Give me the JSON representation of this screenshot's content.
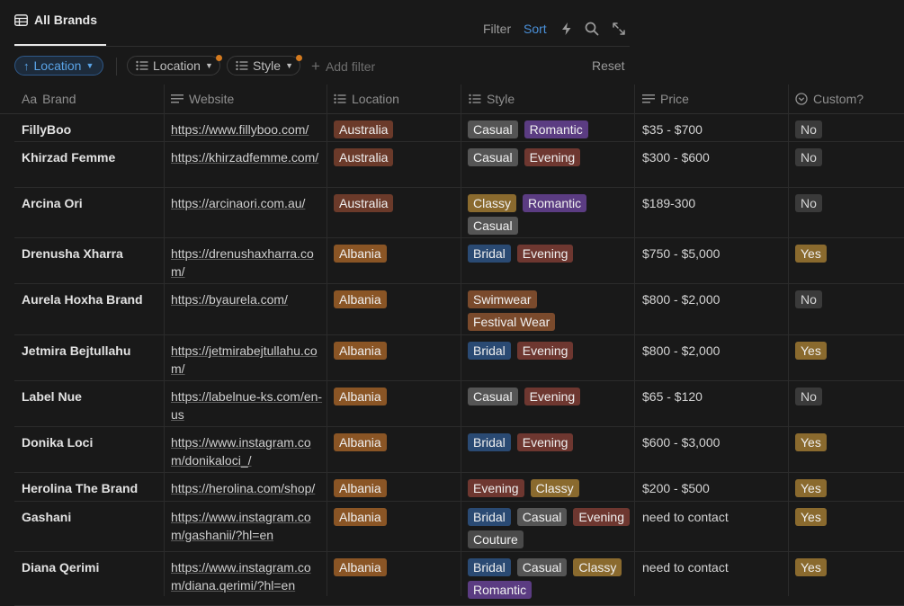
{
  "view": {
    "tab_label": "All Brands"
  },
  "toolbar": {
    "filter": "Filter",
    "sort": "Sort"
  },
  "filters": {
    "sort_chip": "Location",
    "chip_location": "Location",
    "chip_style": "Style",
    "add_filter": "Add filter",
    "reset": "Reset"
  },
  "columns": {
    "brand": "Brand",
    "brand_prefix": "Aa",
    "website": "Website",
    "location": "Location",
    "style": "Style",
    "price": "Price",
    "custom": "Custom?"
  },
  "rows": [
    {
      "brand": "FillyBoo",
      "website": "https://www.fillyboo.com/",
      "location": "Australia",
      "styles": [
        "Casual",
        "Romantic"
      ],
      "price": "$35 - $700",
      "custom": "No"
    },
    {
      "brand": "Khirzad Femme",
      "website": "https://khirzadfemme.com/",
      "location": "Australia",
      "styles": [
        "Casual",
        "Evening"
      ],
      "price": "$300 - $600",
      "custom": "No"
    },
    {
      "brand": "Arcina Ori",
      "website": "https://arcinaori.com.au/",
      "location": "Australia",
      "styles": [
        "Classy",
        "Romantic",
        "Casual"
      ],
      "price": "$189-300",
      "custom": "No"
    },
    {
      "brand": "Drenusha Xharra",
      "website": "https://drenushaxharra.com/",
      "location": "Albania",
      "styles": [
        "Bridal",
        "Evening"
      ],
      "price": "$750 - $5,000",
      "custom": "Yes"
    },
    {
      "brand": "Aurela Hoxha Brand",
      "website": "https://byaurela.com/",
      "location": "Albania",
      "styles": [
        "Swimwear",
        "Festival Wear"
      ],
      "price": "$800 - $2,000",
      "custom": "No"
    },
    {
      "brand": "Jetmira Bejtullahu",
      "website": "https://jetmirabejtullahu.com/",
      "location": "Albania",
      "styles": [
        "Bridal",
        "Evening"
      ],
      "price": "$800 - $2,000",
      "custom": "Yes"
    },
    {
      "brand": "Label Nue",
      "website": "https://labelnue-ks.com/en-us",
      "location": "Albania",
      "styles": [
        "Casual",
        "Evening"
      ],
      "price": "$65 - $120",
      "custom": "No"
    },
    {
      "brand": "Donika Loci",
      "website": "https://www.instagram.com/donikaloci_/",
      "location": "Albania",
      "styles": [
        "Bridal",
        "Evening"
      ],
      "price": "$600 - $3,000",
      "custom": "Yes"
    },
    {
      "brand": "Herolina The Brand",
      "website": "https://herolina.com/shop/",
      "location": "Albania",
      "styles": [
        "Evening",
        "Classy"
      ],
      "price": "$200 - $500",
      "custom": "Yes"
    },
    {
      "brand": "Gashani",
      "website": "https://www.instagram.com/gashanii/?hl=en",
      "location": "Albania",
      "styles": [
        "Bridal",
        "Casual",
        "Evening",
        "Couture"
      ],
      "price": "need to contact",
      "custom": "Yes"
    },
    {
      "brand": "Diana Qerimi",
      "website": "https://www.instagram.com/diana.qerimi/?hl=en",
      "location": "Albania",
      "styles": [
        "Bridal",
        "Casual",
        "Classy",
        "Romantic"
      ],
      "price": "need to contact",
      "custom": "Yes"
    }
  ],
  "colors": {
    "accent": "#4a90d9",
    "sort_chip_bg": "#1d2b3b",
    "indicator_dot": "#d47a1f"
  }
}
